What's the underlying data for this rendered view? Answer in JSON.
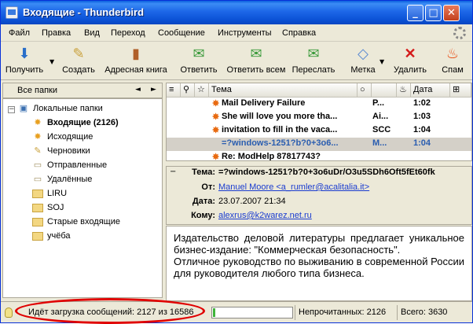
{
  "window": {
    "title": "Входящие - Thunderbird"
  },
  "menu": [
    "Файл",
    "Правка",
    "Вид",
    "Переход",
    "Сообщение",
    "Инструменты",
    "Справка"
  ],
  "toolbar": {
    "get": "Получить",
    "create": "Создать",
    "addressbook": "Адресная книга",
    "reply": "Ответить",
    "replyall": "Ответить всем",
    "forward": "Переслать",
    "tag": "Метка",
    "delete": "Удалить",
    "spam": "Спам"
  },
  "folders": {
    "header": "Все папки",
    "items": [
      {
        "label": "Локальные папки",
        "icon": "computer-icon"
      },
      {
        "label": "Входящие (2126)",
        "icon": "inbox-icon"
      },
      {
        "label": "Исходящие",
        "icon": "outbox-icon"
      },
      {
        "label": "Черновики",
        "icon": "drafts-icon"
      },
      {
        "label": "Отправленные",
        "icon": "sent-icon"
      },
      {
        "label": "Удалённые",
        "icon": "trash-icon"
      },
      {
        "label": "LIRU",
        "icon": "folder-icon"
      },
      {
        "label": "SOJ",
        "icon": "folder-icon"
      },
      {
        "label": "Старые входящие",
        "icon": "folder-icon"
      },
      {
        "label": "учёба",
        "icon": "folder-icon"
      }
    ]
  },
  "threads": {
    "columns": {
      "subject": "Тема",
      "date": "Дата"
    },
    "rows": [
      {
        "subject": "Mail Delivery Failure",
        "sender": "P...",
        "date": "1:02"
      },
      {
        "subject": "She will love you more tha...",
        "sender": "Ai...",
        "date": "1:03"
      },
      {
        "subject": "invitation to fill in the vaca...",
        "sender": "SCC",
        "date": "1:04"
      },
      {
        "subject": "=?windows-1251?b?0+3o6...",
        "sender": "M...",
        "date": "1:04"
      },
      {
        "subject": "Re: ModHelp 87817743?",
        "sender": "",
        "date": ""
      }
    ]
  },
  "message": {
    "labels": {
      "subject": "Тема:",
      "from": "От:",
      "date": "Дата:",
      "to": "Кому:"
    },
    "subject": "=?windows-1251?b?0+3o6uDr/O3u5SDh6Oft5fEt60fk",
    "from": "Manuel Moore <a_rumler@acalitalia.it>",
    "date": "23.07.2007 21:34",
    "to": "alexrus@k2warez.net.ru",
    "body1": "Издательство деловой литературы предлагает уникальное бизнес-издание: \"Коммерческая безопасность\".",
    "body2": "Отличное руководство по выживанию в современной России для руководителя любого типа бизнеса."
  },
  "status": {
    "text": "Идёт загрузка сообщений: 2127 из 16586",
    "progress": 0.03,
    "unread": "Непрочитанных: 2126",
    "total": "Всего: 3630"
  }
}
